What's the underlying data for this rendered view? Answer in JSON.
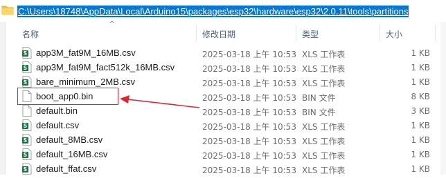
{
  "address_bar": {
    "path": "C:\\Users\\18748\\AppData\\Local\\Arduino15\\packages\\esp32\\hardware\\esp32\\2.0.11\\tools\\partitions",
    "folder_icon": "folder-icon"
  },
  "columns": {
    "name": "名称",
    "modified": "修改日期",
    "type": "类型",
    "size": "大小",
    "sort_indicator": "^"
  },
  "files": [
    {
      "name": "app3M_fat9M_16MB.csv",
      "modified": "2025-03-18 上午 10:53",
      "type": "XLS 工作表",
      "size": "1 KB",
      "icon": "csv-file-icon"
    },
    {
      "name": "app3M_fat9M_fact512k_16MB.csv",
      "modified": "2025-03-18 上午 10:53",
      "type": "XLS 工作表",
      "size": "1 KB",
      "icon": "csv-file-icon"
    },
    {
      "name": "bare_minimum_2MB.csv",
      "modified": "2025-03-18 上午 10:53",
      "type": "XLS 工作表",
      "size": "1 KB",
      "icon": "csv-file-icon"
    },
    {
      "name": "boot_app0.bin",
      "modified": "2025-03-18 上午 10:53",
      "type": "BIN 文件",
      "size": "8 KB",
      "icon": "bin-file-icon"
    },
    {
      "name": "default.bin",
      "modified": "2025-03-18 上午 10:53",
      "type": "BIN 文件",
      "size": "3 KB",
      "icon": "bin-file-icon"
    },
    {
      "name": "default.csv",
      "modified": "2025-03-18 上午 10:53",
      "type": "XLS 工作表",
      "size": "1 KB",
      "icon": "csv-file-icon"
    },
    {
      "name": "default_8MB.csv",
      "modified": "2025-03-18 上午 10:53",
      "type": "XLS 工作表",
      "size": "1 KB",
      "icon": "csv-file-icon"
    },
    {
      "name": "default_16MB.csv",
      "modified": "2025-03-18 上午 10:53",
      "type": "XLS 工作表",
      "size": "1 KB",
      "icon": "csv-file-icon"
    },
    {
      "name": "default_ffat.csv",
      "modified": "2025-03-18 上午 10:53",
      "type": "XLS 工作表",
      "size": "1 KB",
      "icon": "csv-file-icon"
    }
  ],
  "annotation": {
    "highlight_color": "#e0232c",
    "arrow_icon": "red-arrow-icon"
  },
  "colors": {
    "address_selection": "#0078d7",
    "header_text": "#4c607a",
    "excel_green": "#1e7145"
  }
}
